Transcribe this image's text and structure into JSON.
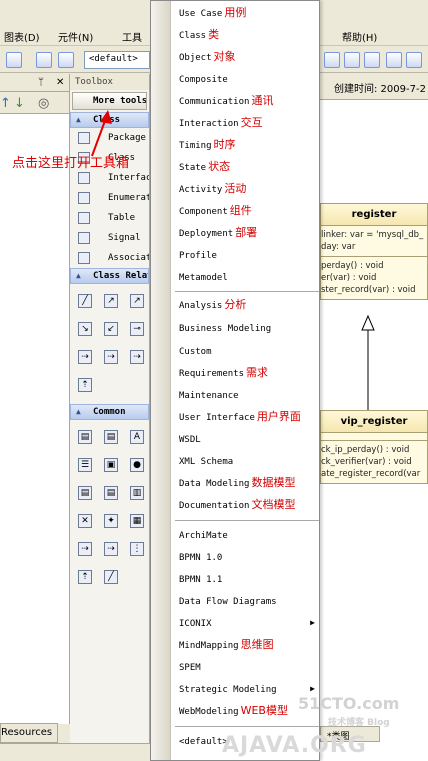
{
  "menubar": {
    "items": [
      "图表(D)",
      "元件(N)",
      "工具",
      "帮助(H)"
    ]
  },
  "toolbar": {
    "combo_value": "<default>"
  },
  "left_pane": {
    "pin": "ᛘ",
    "close": "✕"
  },
  "toolbox": {
    "title": "Toolbox",
    "more_tools": "More tools...",
    "class_section": "Class",
    "class_items": [
      "Package",
      "Class",
      "Interface",
      "Enumeration",
      "Table",
      "Signal",
      "Association"
    ],
    "class_rel_section": "Class Relationships",
    "common_section": "Common"
  },
  "annotation": {
    "text": "点击这里打开工具箱"
  },
  "context_menu": {
    "group1": [
      {
        "en": "Use Case",
        "zh": "用例"
      },
      {
        "en": "Class",
        "zh": "类"
      },
      {
        "en": "Object",
        "zh": "对象"
      },
      {
        "en": "Composite",
        "zh": ""
      },
      {
        "en": "Communication",
        "zh": "通讯"
      },
      {
        "en": "Interaction",
        "zh": "交互"
      },
      {
        "en": "Timing",
        "zh": "时序"
      },
      {
        "en": "State",
        "zh": "状态"
      },
      {
        "en": "Activity",
        "zh": "活动"
      },
      {
        "en": "Component",
        "zh": "组件"
      },
      {
        "en": "Deployment",
        "zh": "部署"
      },
      {
        "en": "Profile",
        "zh": ""
      },
      {
        "en": "Metamodel",
        "zh": ""
      }
    ],
    "group2": [
      {
        "en": "Analysis",
        "zh": "分析"
      },
      {
        "en": "Business Modeling",
        "zh": ""
      },
      {
        "en": "Custom",
        "zh": ""
      },
      {
        "en": "Requirements",
        "zh": "需求"
      },
      {
        "en": "Maintenance",
        "zh": ""
      },
      {
        "en": "User Interface",
        "zh": "用户界面"
      },
      {
        "en": "WSDL",
        "zh": ""
      },
      {
        "en": "XML Schema",
        "zh": ""
      },
      {
        "en": "Data Modeling",
        "zh": "数据模型"
      },
      {
        "en": "Documentation",
        "zh": "文档模型"
      }
    ],
    "group3": [
      {
        "en": "ArchiMate",
        "zh": ""
      },
      {
        "en": "BPMN 1.0",
        "zh": ""
      },
      {
        "en": "BPMN 1.1",
        "zh": ""
      },
      {
        "en": "Data Flow Diagrams",
        "zh": ""
      },
      {
        "en": "ICONIX",
        "zh": "",
        "submenu": true
      },
      {
        "en": "MindMapping",
        "zh": "思维图"
      },
      {
        "en": "SPEM",
        "zh": ""
      },
      {
        "en": "Strategic Modeling",
        "zh": "",
        "submenu": true
      },
      {
        "en": "WebModeling",
        "zh": "WEB模型"
      }
    ],
    "group4": [
      {
        "en": "<default>",
        "zh": ""
      }
    ]
  },
  "diagram": {
    "created_label": "创建时间: 2009-7-2",
    "register": {
      "name": "register",
      "attrs": [
        "linker:  var = 'mysql_db_",
        "day:  var"
      ],
      "ops": [
        "perday() : void",
        "er(var) : void",
        "ster_record(var) : void"
      ]
    },
    "vip_register": {
      "name": "vip_register",
      "ops": [
        "ck_ip_perday() : void",
        "ck_verifier(var) : void",
        "ate_register_record(var"
      ]
    },
    "bottom_tab": "*类图"
  },
  "resources_tab": "Resources",
  "watermarks": {
    "site": "51CTO.com",
    "blog": "技术博客 Blog",
    "ajava": "AJAVA.ORG"
  },
  "colors": {
    "annotation": "#e00000",
    "menu_zh": "#d40000"
  }
}
